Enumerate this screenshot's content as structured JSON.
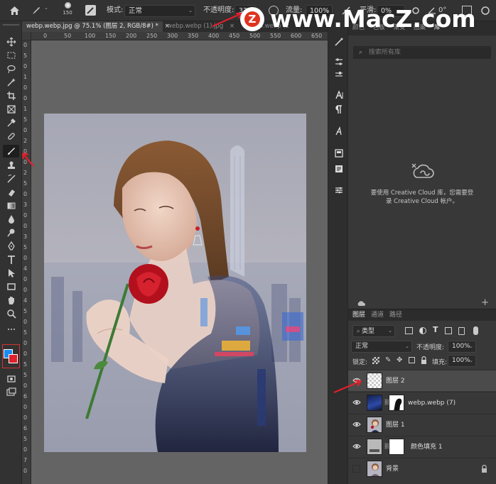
{
  "options_bar": {
    "brush_size": "150",
    "mode_label": "模式:",
    "mode_value": "正常",
    "opacity_label": "不透明度:",
    "opacity_value": "33%",
    "flow_label": "流量:",
    "flow_value": "100%",
    "smoothing_label": "平滑:",
    "smoothing_value": "0%",
    "angle_value": "0°"
  },
  "document_tabs": [
    {
      "label": "webp.webp.jpg @ 75.1% (图层 2, RGB/8#) *",
      "close": "×"
    },
    {
      "label": "webp.webp (1).jpg",
      "close": "×"
    },
    {
      "label": "webp.webp (2",
      "close": ""
    }
  ],
  "ruler_top": [
    "0",
    "50",
    "100",
    "150",
    "200",
    "250",
    "300",
    "350",
    "400",
    "450",
    "500",
    "550",
    "600",
    "650"
  ],
  "ruler_left": [
    "0",
    "5",
    "0",
    "1",
    "0",
    "0",
    "1",
    "5",
    "0",
    "2",
    "0",
    "0",
    "2",
    "5",
    "0",
    "3",
    "0",
    "0",
    "3",
    "5",
    "0",
    "4",
    "0",
    "0",
    "4",
    "5",
    "0",
    "5",
    "0",
    "0",
    "5",
    "5",
    "0",
    "6",
    "0",
    "0",
    "6",
    "5",
    "0",
    "7",
    "0"
  ],
  "library_panel": {
    "tabs": [
      "颜色",
      "色板",
      "渐变",
      "图案",
      "库"
    ],
    "search_placeholder": "搜索所有库",
    "cc_message_line1": "要使用 Creative Cloud 库，您需要登",
    "cc_message_line2": "录 Creative Cloud 帐户。"
  },
  "layers_panel": {
    "tabs": [
      "图层",
      "通道",
      "路径"
    ],
    "filter_value": "类型",
    "blend_mode": "正常",
    "opacity_label": "不透明度:",
    "opacity_value": "100%",
    "lock_label": "锁定:",
    "fill_label": "填充:",
    "fill_value": "100%",
    "layers": [
      {
        "name": "图层 2",
        "visible": true,
        "selected": true
      },
      {
        "name": "webp.webp (7)",
        "visible": true,
        "selected": false
      },
      {
        "name": "图层 1",
        "visible": true,
        "selected": false
      },
      {
        "name": "颜色填充 1",
        "visible": true,
        "selected": false
      },
      {
        "name": "背景",
        "visible": false,
        "selected": false
      }
    ]
  },
  "watermark": {
    "logo_letter": "Z",
    "text": "www.MacZ.com"
  },
  "colors": {
    "foreground": "#1a8bf0",
    "background": "#e0202b",
    "annotation_arrow": "#e0202b"
  },
  "icons": [
    "home-icon",
    "brush-icon",
    "move-icon",
    "marquee-icon",
    "lasso-icon",
    "magic-wand-icon",
    "crop-icon",
    "frame-icon",
    "eyedropper-icon",
    "healing-icon",
    "brush-tool-icon",
    "stamp-icon",
    "history-brush-icon",
    "eraser-icon",
    "gradient-icon",
    "blur-icon",
    "dodge-icon",
    "pen-icon",
    "type-icon",
    "path-select-icon",
    "rectangle-icon",
    "hand-icon",
    "zoom-icon",
    "more-icon",
    "quick-mask-icon",
    "screen-mode-icon",
    "eye-icon",
    "lock-icon",
    "search-icon",
    "creative-cloud-icon"
  ]
}
